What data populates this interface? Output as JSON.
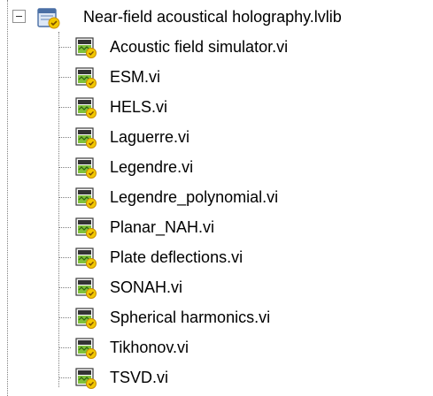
{
  "tree": {
    "library": {
      "label": "Near-field acoustical holography.lvlib",
      "icon": "lvlib-icon",
      "expanded": true
    },
    "items": [
      {
        "label": "Acoustic field simulator.vi",
        "icon": "vi-icon"
      },
      {
        "label": "ESM.vi",
        "icon": "vi-icon"
      },
      {
        "label": "HELS.vi",
        "icon": "vi-icon"
      },
      {
        "label": "Laguerre.vi",
        "icon": "vi-icon"
      },
      {
        "label": "Legendre.vi",
        "icon": "vi-icon"
      },
      {
        "label": "Legendre_polynomial.vi",
        "icon": "vi-icon"
      },
      {
        "label": "Planar_NAH.vi",
        "icon": "vi-icon"
      },
      {
        "label": "Plate deflections.vi",
        "icon": "vi-icon"
      },
      {
        "label": "SONAH.vi",
        "icon": "vi-icon"
      },
      {
        "label": "Spherical harmonics.vi",
        "icon": "vi-icon"
      },
      {
        "label": "Tikhonov.vi",
        "icon": "vi-icon"
      },
      {
        "label": "TSVD.vi",
        "icon": "vi-icon"
      }
    ]
  },
  "colors": {
    "connector": "#7f7f7f",
    "text": "#000000",
    "background": "#ffffff",
    "vi_green": "#7fc03a",
    "vi_yellow": "#f2c800"
  }
}
